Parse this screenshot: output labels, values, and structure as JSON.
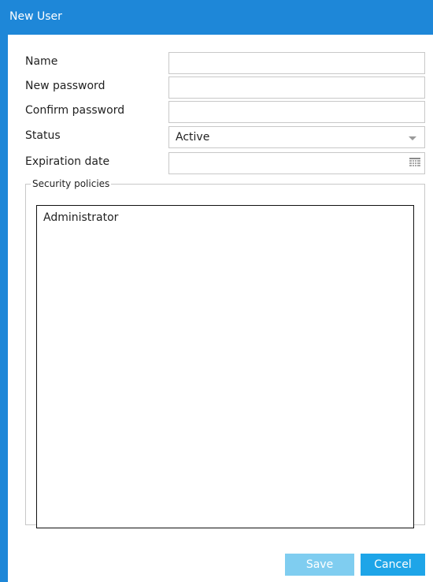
{
  "dialog": {
    "title": "New User"
  },
  "form": {
    "name_label": "Name",
    "name_value": "",
    "new_password_label": "New password",
    "new_password_value": "",
    "confirm_password_label": "Confirm password",
    "confirm_password_value": "",
    "status_label": "Status",
    "status_value": "Active",
    "expiration_label": "Expiration date",
    "expiration_value": ""
  },
  "policies": {
    "legend": "Security policies",
    "items": [
      {
        "label": "Administrator"
      }
    ]
  },
  "buttons": {
    "save_label": "Save",
    "cancel_label": "Cancel"
  },
  "colors": {
    "accent": "#1e87d8",
    "save_disabled": "#7fcdf0",
    "cancel": "#1ea5e8"
  },
  "icons": {
    "status_dropdown": "chevron-down-icon",
    "expiration_picker": "calendar-icon"
  }
}
